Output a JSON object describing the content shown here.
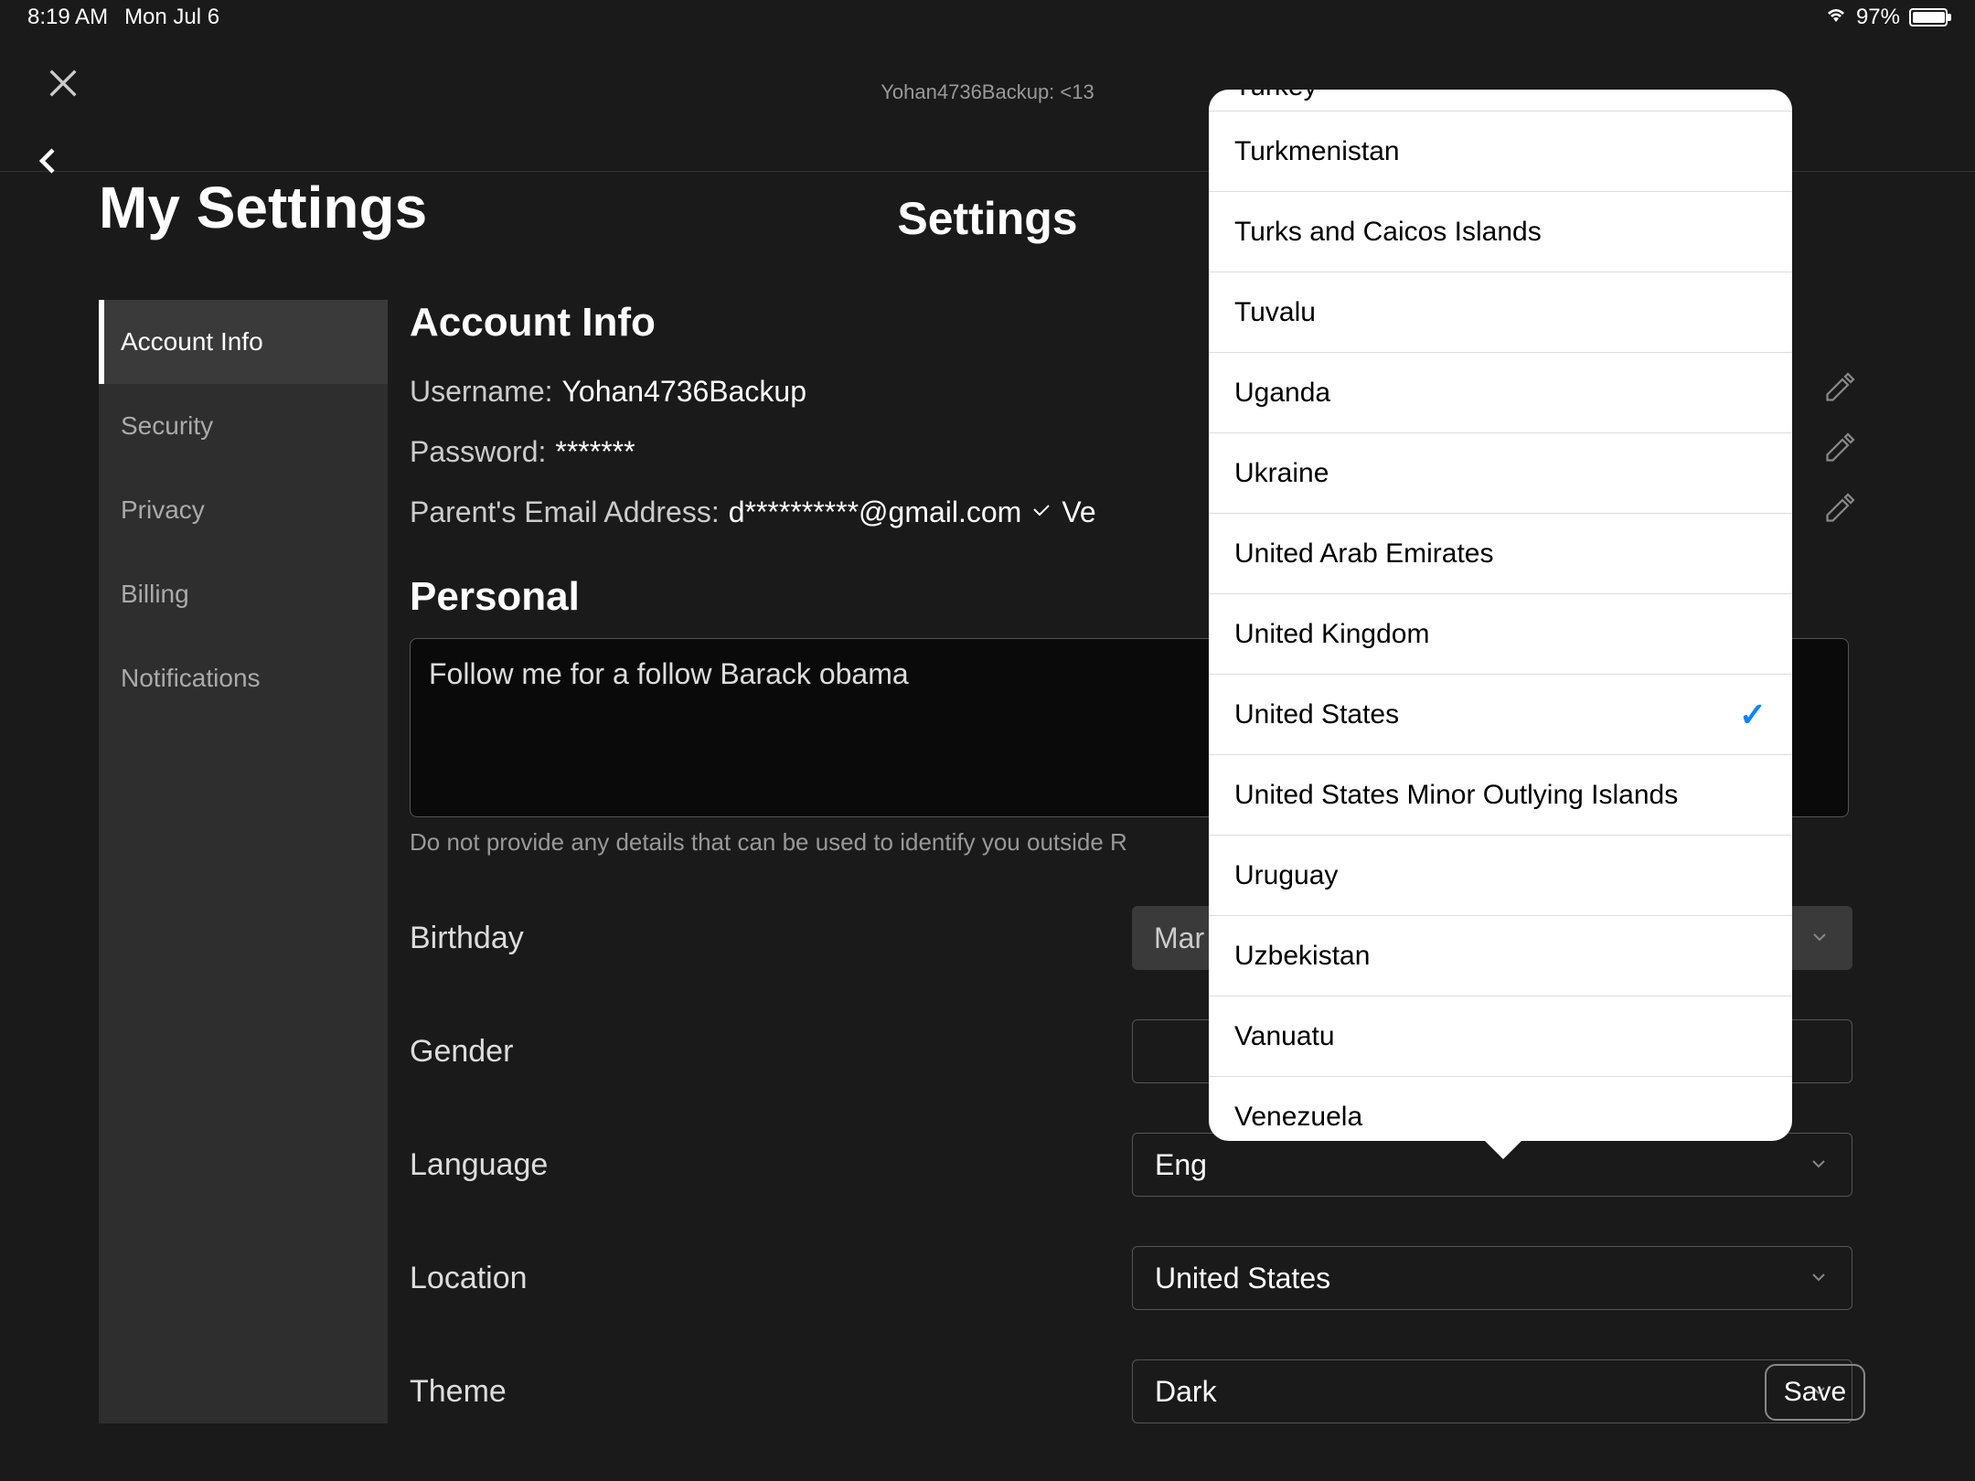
{
  "status_bar": {
    "time": "8:19 AM",
    "date": "Mon Jul 6",
    "battery": "97%"
  },
  "subtitle": "Yohan4736Backup: <13",
  "page_title": "Settings",
  "heading": "My Settings",
  "sidebar": {
    "items": [
      {
        "label": "Account Info",
        "active": true
      },
      {
        "label": "Security"
      },
      {
        "label": "Privacy"
      },
      {
        "label": "Billing"
      },
      {
        "label": "Notifications"
      }
    ]
  },
  "account_info": {
    "title": "Account Info",
    "username_label": "Username:",
    "username_value": "Yohan4736Backup",
    "password_label": "Password:",
    "password_value": "*******",
    "parent_email_label": "Parent's Email Address:",
    "parent_email_value": "d**********@gmail.com",
    "verified_text": "Ve"
  },
  "personal": {
    "title": "Personal",
    "bio": "Follow me for a follow Barack obama",
    "bio_hint": "Do not provide any details that can be used to identify you outside R",
    "fields": {
      "birthday_label": "Birthday",
      "birthday_value": "Mar",
      "gender_label": "Gender",
      "gender_value": "",
      "language_label": "Language",
      "language_value": "Eng",
      "location_label": "Location",
      "location_value": "United States",
      "theme_label": "Theme",
      "theme_value": "Dark"
    }
  },
  "save_label": "Save",
  "dropdown": {
    "items": [
      {
        "label": "Turkey"
      },
      {
        "label": "Turkmenistan"
      },
      {
        "label": "Turks and Caicos Islands"
      },
      {
        "label": "Tuvalu"
      },
      {
        "label": "Uganda"
      },
      {
        "label": "Ukraine"
      },
      {
        "label": "United Arab Emirates"
      },
      {
        "label": "United Kingdom"
      },
      {
        "label": "United States",
        "checked": true
      },
      {
        "label": "United States Minor Outlying Islands"
      },
      {
        "label": "Uruguay"
      },
      {
        "label": "Uzbekistan"
      },
      {
        "label": "Vanuatu"
      },
      {
        "label": "Venezuela"
      }
    ]
  }
}
